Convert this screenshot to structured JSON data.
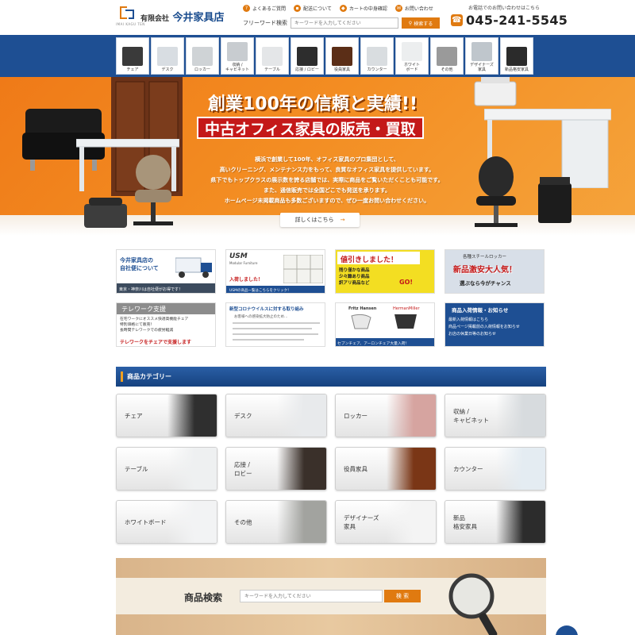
{
  "header": {
    "logo_sub": "IMAI KAGU TEN",
    "company_prefix": "有限会社",
    "company_name": "今井家具店",
    "links": [
      {
        "icon": "question-icon",
        "label": "よくあるご質問"
      },
      {
        "icon": "truck-icon",
        "label": "配送について"
      },
      {
        "icon": "cart-icon",
        "label": "カートの中身確認"
      },
      {
        "icon": "mail-icon",
        "label": "お問い合わせ"
      }
    ],
    "search_label": "フリーワード検索",
    "search_placeholder": "キーワードを入力してください",
    "search_button": "検索する",
    "tel_note": "お電話でのお問い合わせはこちら",
    "tel": "045-241-5545"
  },
  "nav": [
    {
      "label": "チェア",
      "color": "#3a3a3a"
    },
    {
      "label": "デスク",
      "color": "#d8dde2"
    },
    {
      "label": "ロッカー",
      "color": "#cfd3d6"
    },
    {
      "label": "収納 /\nキャビネット",
      "color": "#c8ccd0"
    },
    {
      "label": "テーブル",
      "color": "#e4e6e8"
    },
    {
      "label": "応接 / ロビー",
      "color": "#2d2d2d"
    },
    {
      "label": "役員家具",
      "color": "#5b2e17"
    },
    {
      "label": "カウンター",
      "color": "#d9dde0"
    },
    {
      "label": "ホワイト\nボード",
      "color": "#eceeef"
    },
    {
      "label": "その他",
      "color": "#9a9a9a"
    },
    {
      "label": "デザイナーズ\n家具",
      "color": "#bfc6cc"
    },
    {
      "label": "新品格安家具",
      "color": "#2b2b2b"
    }
  ],
  "hero": {
    "headline": "創業100年の信頼と実績!!",
    "subheadline": "中古オフィス家具の販売・買取",
    "lines": [
      "横浜で創業して100年、オフィス家具のプロ集団として、",
      "高いクリーニング、メンテナンス力をもって、良質なオフィス家具を提供しています。",
      "県下でもトップクラスの展示数を誇る店舗では、実際に商品をご覧いただくことも可能です。",
      "また、通信販売では全国どこでも発送を承ります。",
      "ホームページ未掲載商品も多数ございますので、ぜひ一度お問い合わせください。"
    ],
    "button": "詳しくはこちら",
    "button_arrow": "→"
  },
  "banners": [
    {
      "title": "今井家具店の\n自社便について",
      "sub": "東京・神奈川は自社便がお得です！"
    },
    {
      "title": "USM",
      "sub": "Modular Furniture",
      "tag": "入荷しました！",
      "note": "USMの商品一覧はこちらをクリック！"
    },
    {
      "title": "値引きしました！",
      "sub": "残り僅かな商品\n少々難あり商品\n訳アリ商品など",
      "tag": "GO!"
    },
    {
      "title": "新品激安大人気！",
      "sub": "各種スチールロッカー",
      "tag": "選ぶなら今がチャンス"
    },
    {
      "title": "テレワーク支援",
      "sub": "在宅ワークにオススメ快適高機能チェア\n特別価格にて販売！\n長時間テレワークでの疲労軽減",
      "tag": "テレワークをチェアで支援します"
    },
    {
      "title": "新型コロナウイルスに対する取り組み",
      "sub": "お客様への感染拡大防止のため…"
    },
    {
      "title": "Fritz Hansen",
      "sub": "HermanMiller",
      "tag": "セブンチェア、アーロンチェア大量入荷！"
    },
    {
      "title": "商品入荷情報・お知らせ",
      "sub": "最新入荷情報はこちら\n商品ページ掲載前の入荷情報をお知らせ\nお店の休業日等のお知らせ"
    }
  ],
  "categories_title": "商品カテゴリー",
  "categories": [
    {
      "label": "チェア",
      "color": "#2f2f2f"
    },
    {
      "label": "デスク",
      "color": "#e8eaec"
    },
    {
      "label": "ロッカー",
      "color": "#d6a4a0"
    },
    {
      "label": "収納 /\nキャビネット",
      "color": "#d7dbde"
    },
    {
      "label": "テーブル",
      "color": "#eef0f1"
    },
    {
      "label": "応接 /\nロビー",
      "color": "#3a302a"
    },
    {
      "label": "役員家具",
      "color": "#7a3616"
    },
    {
      "label": "カウンター",
      "color": "#e4ecf2"
    },
    {
      "label": "ホワイトボード",
      "color": "#f2f3f4"
    },
    {
      "label": "その他",
      "color": "#a2a39f"
    },
    {
      "label": "デザイナーズ\n家具",
      "color": "#f4f4f4"
    },
    {
      "label": "新品\n格安家具",
      "color": "#2c2c2c"
    }
  ],
  "bottom_search": {
    "label": "商品検索",
    "placeholder": "キーワードを入力してください",
    "button": "検 索"
  },
  "colors": {
    "brand_blue": "#1e4f93",
    "accent_orange": "#e07a10",
    "hero_red": "#c41919"
  }
}
